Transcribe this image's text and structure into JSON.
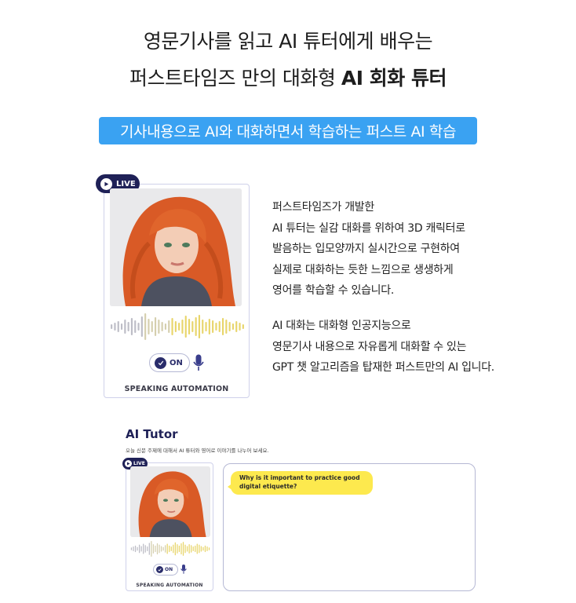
{
  "headline": {
    "line1": "영문기사를 읽고 AI 튜터에게 배우는",
    "line2_regular": "퍼스트타임즈 만의 대화형",
    "line2_bold": "AI 회화 튜터"
  },
  "banner": {
    "text": "기사내용으로 AI와 대화하면서 학습하는 퍼스트 AI 학습"
  },
  "card": {
    "live_label": "LIVE",
    "toggle_label": "ON",
    "speaking_label": "SPEAKING AUTOMATION"
  },
  "description": {
    "para1": [
      "퍼스트타임즈가 개발한",
      "AI 튜터는 실감 대화를 위하여 3D 캐릭터로",
      "발음하는 입모양까지 실시간으로 구현하여",
      "실제로 대화하는 듯한 느낌으로 생생하게",
      "영어를 학습할 수 있습니다."
    ],
    "para2": [
      "AI 대화는 대화형 인공지능으로",
      "영문기사 내용으로 자유롭게 대화할 수 있는",
      "GPT 챗 알고리즘을 탑재한 퍼스트만의 AI 입니다."
    ]
  },
  "tutor": {
    "title": "AI Tutor",
    "subtitle": "오늘 신문 주제에 대해서 AI 튜터와 영어로 이야기를 나누어 보세요.",
    "live_label": "LIVE",
    "toggle_label": "ON",
    "speaking_label": "SPEAKING AUTOMATION",
    "chat_message_line1": "Why is it important to practice good",
    "chat_message_line2": "digital etiquette?"
  },
  "icons": [
    "play-icon",
    "check-icon",
    "microphone-icon"
  ],
  "colors": {
    "banner": "#3aa2f2",
    "navy": "#1f2157",
    "bubble": "#fde94e",
    "hair": "#e0652c",
    "wave_gray": "#bdbdc6",
    "wave_yellow": "#e8d56b"
  }
}
